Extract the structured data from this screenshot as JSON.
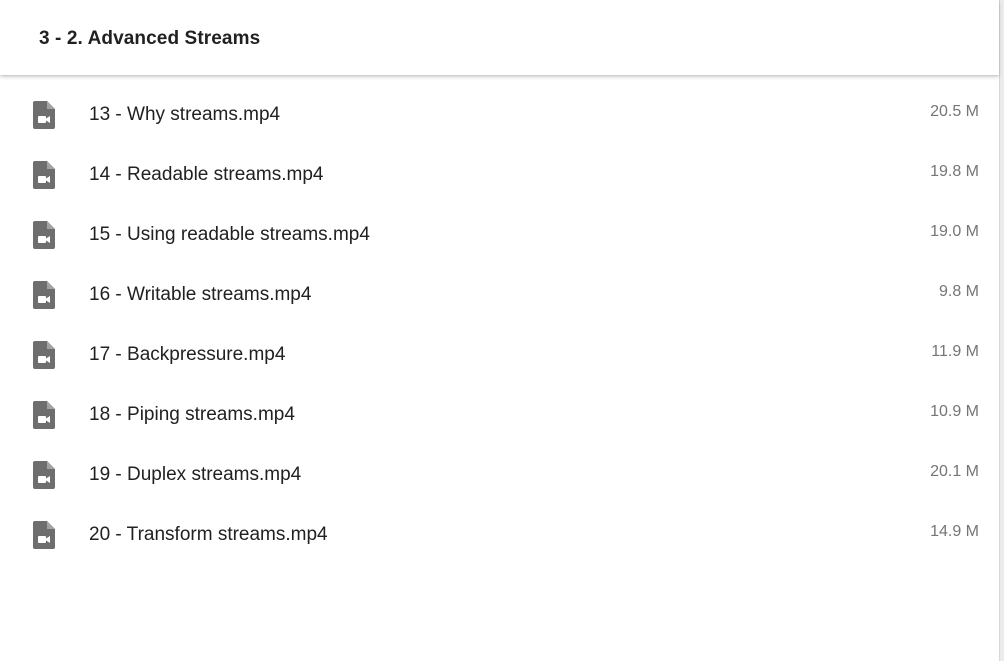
{
  "header": {
    "title": "3 - 2. Advanced Streams"
  },
  "colors": {
    "icon": "#6e6e6e",
    "text_primary": "#212121",
    "text_secondary": "#757575"
  },
  "files": [
    {
      "name": "13 - Why streams.mp4",
      "size": "20.5 M",
      "icon": "video-file-icon"
    },
    {
      "name": "14 - Readable streams.mp4",
      "size": "19.8 M",
      "icon": "video-file-icon"
    },
    {
      "name": "15 - Using readable streams.mp4",
      "size": "19.0 M",
      "icon": "video-file-icon"
    },
    {
      "name": "16 - Writable streams.mp4",
      "size": "9.8 M",
      "icon": "video-file-icon"
    },
    {
      "name": "17 - Backpressure.mp4",
      "size": "11.9 M",
      "icon": "video-file-icon"
    },
    {
      "name": "18 - Piping streams.mp4",
      "size": "10.9 M",
      "icon": "video-file-icon"
    },
    {
      "name": "19 - Duplex streams.mp4",
      "size": "20.1 M",
      "icon": "video-file-icon"
    },
    {
      "name": "20 - Transform streams.mp4",
      "size": "14.9 M",
      "icon": "video-file-icon"
    }
  ]
}
